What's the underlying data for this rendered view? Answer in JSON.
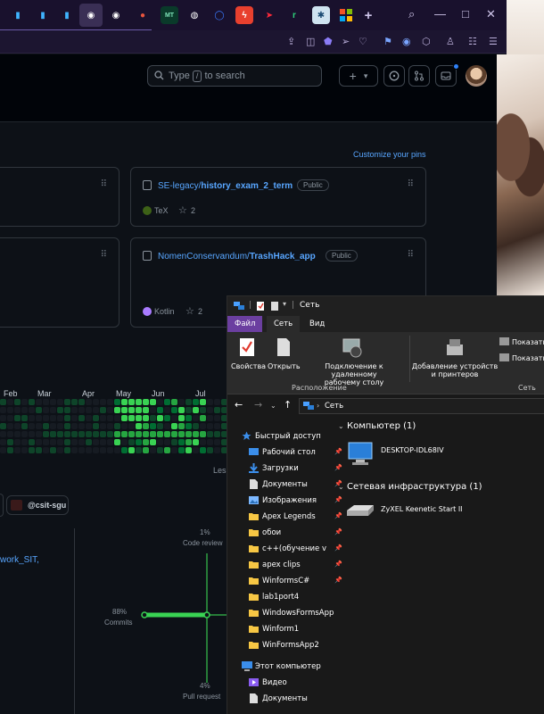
{
  "browser": {
    "tabs": [
      "chart",
      "chart",
      "chart",
      "github",
      "github",
      "cat",
      "mt",
      "globe",
      "search",
      "bolt",
      "arrow",
      "r",
      "gear",
      "grid"
    ],
    "new_tab": "+",
    "controls": {
      "search": "⌕",
      "minimize": "—",
      "maximize": "□",
      "close": "✕"
    },
    "toolbar_icons": [
      "share-icon",
      "camera-icon",
      "shield-icon",
      "send-icon",
      "heart-icon",
      "flag-icon",
      "vpn-icon",
      "cube-icon",
      "person-icon",
      "list-icon",
      "menu-icon"
    ]
  },
  "header": {
    "search_placeholder_pre": "Type",
    "search_key": "/",
    "search_placeholder_post": "to search",
    "new_label": "+",
    "dropdown": "▾"
  },
  "pinned": {
    "customize_label": "Customize your pins",
    "cards": [
      {
        "owner": "SE-legacy/",
        "repo": "history_exam_2_term",
        "visibility": "Public",
        "language": "TeX",
        "lang_color": "#3d6117",
        "stars": "2"
      },
      {
        "owner": "NomenConservandum/",
        "repo": "TrashHack_app",
        "visibility": "Public",
        "language": "Kotlin",
        "lang_color": "#a97bff",
        "stars": "2"
      }
    ]
  },
  "contrib": {
    "months": [
      "Feb",
      "Mar",
      "Apr",
      "May",
      "Jun",
      "Jul"
    ],
    "legend_less": "Les"
  },
  "org": {
    "name": "@csit-sgu"
  },
  "profile": {
    "link": "work_SIT,"
  },
  "activity": {
    "code_review_pct": "1%",
    "code_review_label": "Code review",
    "commits_pct": "88%",
    "commits_label": "Commits",
    "pull_requests_pct": "4%",
    "pull_requests_label": "Pull request"
  },
  "explorer": {
    "title": "Сеть",
    "tabs": [
      "Файл",
      "Сеть",
      "Вид"
    ],
    "ribbon": {
      "properties": "Свойства",
      "open": "Открыть",
      "remote_line1": "Подключение к удаленному",
      "remote_line2": "рабочему столу",
      "add_line1": "Добавление устройств",
      "add_line2": "и принтеров",
      "show1": "Показать",
      "show2": "Показать",
      "group_location": "Расположение",
      "group_network": "Сеть"
    },
    "address": "Сеть",
    "nav": [
      {
        "label": "Быстрый доступ",
        "icon": "star",
        "pinned": false
      },
      {
        "label": "Рабочий стол",
        "icon": "desktop",
        "pinned": true
      },
      {
        "label": "Загрузки",
        "icon": "download",
        "pinned": true
      },
      {
        "label": "Документы",
        "icon": "doc",
        "pinned": true
      },
      {
        "label": "Изображения",
        "icon": "image",
        "pinned": true
      },
      {
        "label": "Apex Legends",
        "icon": "folder",
        "pinned": true
      },
      {
        "label": "обои",
        "icon": "folder",
        "pinned": true
      },
      {
        "label": "c++(обучение v",
        "icon": "folder",
        "pinned": true
      },
      {
        "label": "apex clips",
        "icon": "folder",
        "pinned": true
      },
      {
        "label": "WinformsC#",
        "icon": "folder",
        "pinned": true
      },
      {
        "label": "lab1port4",
        "icon": "folder",
        "pinned": false
      },
      {
        "label": "WindowsFormsApp",
        "icon": "folder",
        "pinned": false
      },
      {
        "label": "Winform1",
        "icon": "folder",
        "pinned": false
      },
      {
        "label": "WinFormsApp2",
        "icon": "folder",
        "pinned": false
      },
      {
        "label": "Этот компьютер",
        "icon": "pc",
        "pinned": false
      },
      {
        "label": "Видео",
        "icon": "video",
        "pinned": false
      },
      {
        "label": "Документы",
        "icon": "doc",
        "pinned": false
      }
    ],
    "sections": [
      {
        "title": "Компьютер (1)",
        "item": "DESKTOP-IDL68IV"
      },
      {
        "title": "Сетевая инфраструктура (1)",
        "item": "ZyXEL Keenetic Start II"
      }
    ]
  },
  "colors": {
    "accent": "#58a6ff",
    "bg": "#0d1117",
    "green": "#39d353"
  }
}
